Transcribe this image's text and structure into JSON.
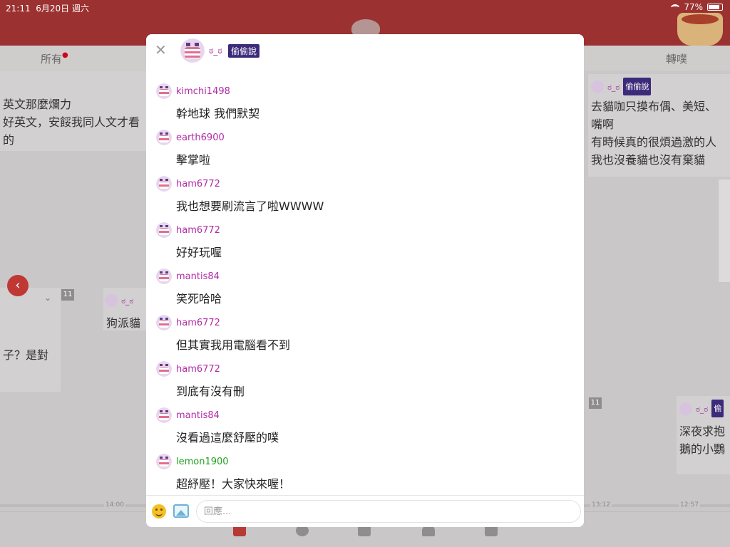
{
  "status_bar": {
    "time": "21:11",
    "date": "6月20日 週六",
    "battery": "77%"
  },
  "tabs": [
    {
      "label": "所有",
      "has_dot": true
    },
    {
      "label": "轉噗",
      "has_dot": false
    }
  ],
  "background": {
    "left_card_lines": [
      "英文那麼爛力",
      "好英文，安餒我同人文才看的"
    ],
    "left_card2_lines": [
      "子？是對"
    ],
    "center_card": {
      "name": "ಠ_ಠ",
      "text": "狗派貓"
    },
    "right_card": {
      "name": "ಠ_ಠ",
      "tag": "偷偷說",
      "lines": [
        "去貓咖只摸布偶、美短、",
        "嘴啊",
        "有時候真的很煩過激的人",
        "我也沒養貓也沒有棄貓"
      ]
    },
    "right_card2": {
      "name": "ಠ_ಠ",
      "tag": "偷",
      "lines": [
        "深夜求抱",
        "鵝的小鸚"
      ]
    },
    "badges": [
      "11",
      "11"
    ],
    "timeline_labels": [
      "14:00",
      "13:12",
      "12:57"
    ]
  },
  "modal": {
    "header": {
      "name": "ಠ_ಠ",
      "tag": "偷偷說"
    },
    "messages": [
      {
        "user": "kimchi1498",
        "text": "幹地球 我們默契",
        "color": "purple"
      },
      {
        "user": "earth6900",
        "text": "擊掌啦",
        "color": "purple"
      },
      {
        "user": "ham6772",
        "text": "我也想要刷流言了啦WWWW",
        "color": "purple"
      },
      {
        "user": "ham6772",
        "text": "好好玩喔",
        "color": "purple"
      },
      {
        "user": "mantis84",
        "text": "笑死哈哈",
        "color": "purple"
      },
      {
        "user": "ham6772",
        "text": "但其實我用電腦看不到",
        "color": "purple"
      },
      {
        "user": "ham6772",
        "text": "到底有沒有刪",
        "color": "purple"
      },
      {
        "user": "mantis84",
        "text": "沒看過這麼舒壓的噗",
        "color": "purple"
      },
      {
        "user": "lemon1900",
        "text": "超紓壓！大家快來喔！",
        "color": "green"
      }
    ],
    "reply_placeholder": "回應..."
  }
}
